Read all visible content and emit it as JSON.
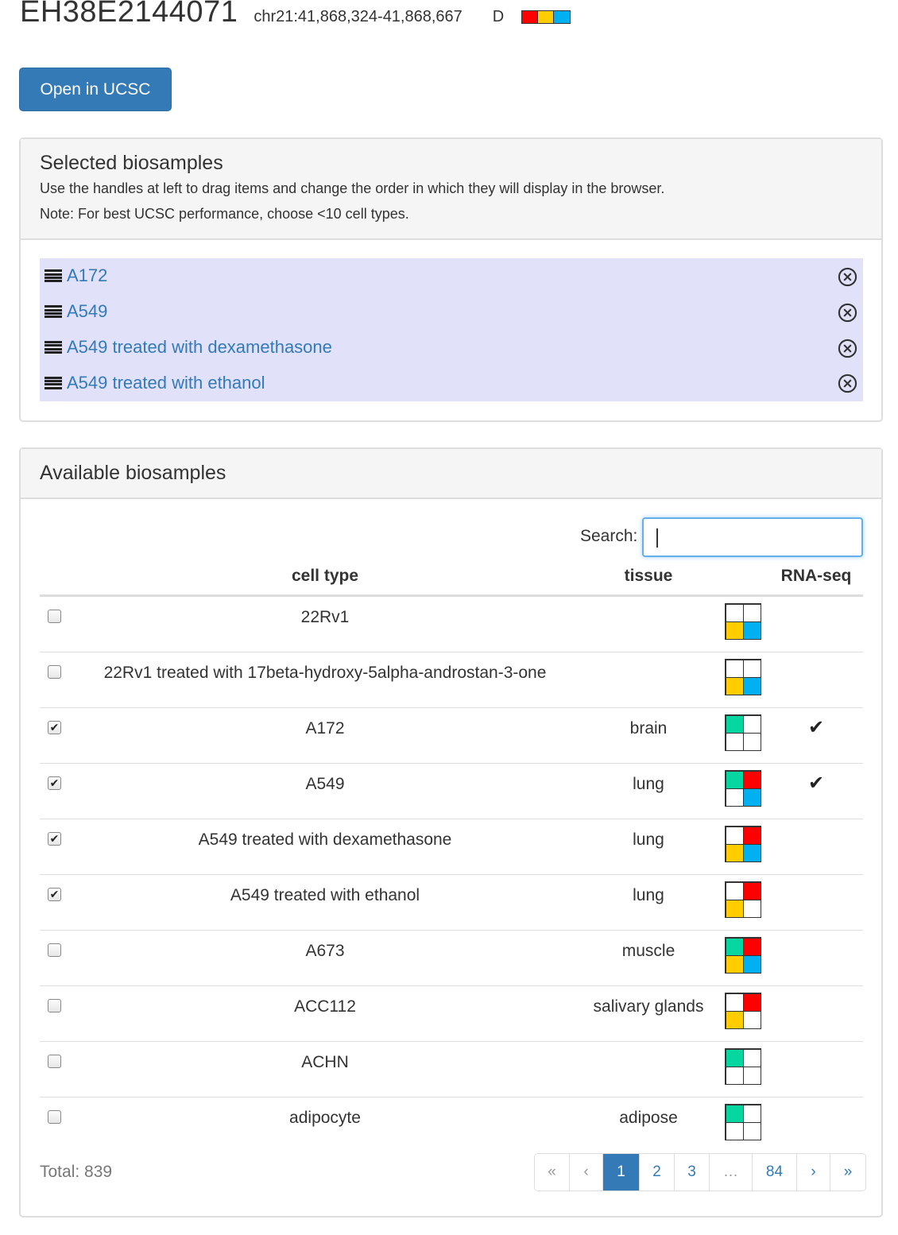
{
  "header": {
    "accession": "EH38E2144071",
    "coordinates": "chr21:41,868,324-41,868,667",
    "classification": "D",
    "class_colors": [
      "#ff0000",
      "#ffcd00",
      "#00b0f0"
    ]
  },
  "ucsc_button": {
    "label": "Open in UCSC"
  },
  "selected": {
    "title": "Selected biosamples",
    "hint1": "Use the handles at left to drag items and change the order in which they will display in the browser.",
    "hint2": "Note: For best UCSC performance, choose <10 cell types.",
    "items": [
      "A172",
      "A549",
      "A549 treated with dexamethasone",
      "A549 treated with ethanol"
    ]
  },
  "available": {
    "title": "Available biosamples",
    "search_label": "Search:",
    "search_value": "",
    "columns": {
      "cell_type": "cell type",
      "tissue": "tissue",
      "rna_seq": "RNA-seq"
    },
    "rows": [
      {
        "cell_type": "22Rv1",
        "tissue": "",
        "checked": false,
        "rna_seq": false,
        "grid": [
          "",
          "",
          "#ffcd00",
          "#00b0f0"
        ]
      },
      {
        "cell_type": "22Rv1 treated with 17beta-hydroxy-5alpha-androstan-3-one",
        "tissue": "",
        "checked": false,
        "rna_seq": false,
        "grid": [
          "",
          "",
          "#ffcd00",
          "#00b0f0"
        ]
      },
      {
        "cell_type": "A172",
        "tissue": "brain",
        "checked": true,
        "rna_seq": true,
        "grid": [
          "#06d6a0",
          "",
          "",
          ""
        ]
      },
      {
        "cell_type": "A549",
        "tissue": "lung",
        "checked": true,
        "rna_seq": true,
        "grid": [
          "#06d6a0",
          "#ff0000",
          "",
          "#00b0f0"
        ]
      },
      {
        "cell_type": "A549 treated with dexamethasone",
        "tissue": "lung",
        "checked": true,
        "rna_seq": false,
        "grid": [
          "",
          "#ff0000",
          "#ffcd00",
          "#00b0f0"
        ]
      },
      {
        "cell_type": "A549 treated with ethanol",
        "tissue": "lung",
        "checked": true,
        "rna_seq": false,
        "grid": [
          "",
          "#ff0000",
          "#ffcd00",
          ""
        ]
      },
      {
        "cell_type": "A673",
        "tissue": "muscle",
        "checked": false,
        "rna_seq": false,
        "grid": [
          "#06d6a0",
          "#ff0000",
          "#ffcd00",
          "#00b0f0"
        ]
      },
      {
        "cell_type": "ACC112",
        "tissue": "salivary glands",
        "checked": false,
        "rna_seq": false,
        "grid": [
          "",
          "#ff0000",
          "#ffcd00",
          ""
        ]
      },
      {
        "cell_type": "ACHN",
        "tissue": "",
        "checked": false,
        "rna_seq": false,
        "grid": [
          "#06d6a0",
          "",
          "",
          ""
        ]
      },
      {
        "cell_type": "adipocyte",
        "tissue": "adipose",
        "checked": false,
        "rna_seq": false,
        "grid": [
          "#06d6a0",
          "",
          "",
          ""
        ]
      }
    ],
    "total": "Total: 839",
    "pagination": [
      {
        "label": "«",
        "state": "disabled"
      },
      {
        "label": "‹",
        "state": "disabled"
      },
      {
        "label": "1",
        "state": "active"
      },
      {
        "label": "2",
        "state": ""
      },
      {
        "label": "3",
        "state": ""
      },
      {
        "label": "…",
        "state": "disabled"
      },
      {
        "label": "84",
        "state": ""
      },
      {
        "label": "›",
        "state": ""
      },
      {
        "label": "»",
        "state": ""
      }
    ]
  }
}
